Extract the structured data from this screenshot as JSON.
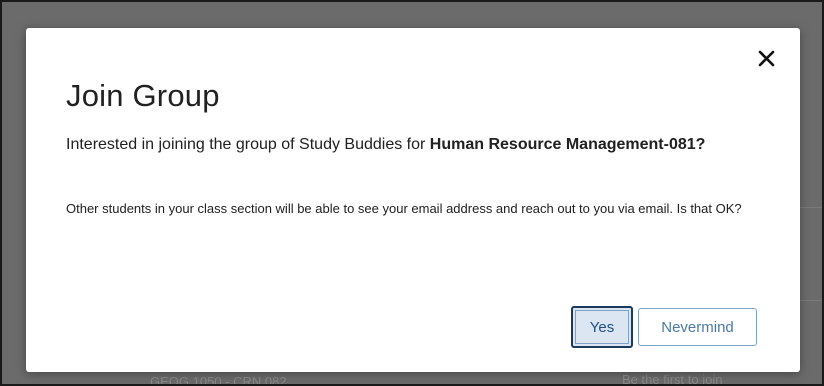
{
  "background": {
    "course_peek": "GEOG 1050 - CRN 082",
    "join_peek": "Be the first to join"
  },
  "dialog": {
    "title": "Join Group",
    "question_prefix": "Interested in joining the group of Study Buddies for ",
    "question_course": "Human Resource Management-081?",
    "notice": "Other students in your class section will be able to see your email address and reach out to you via email. Is that OK?",
    "close_icon": "close-icon",
    "yes_label": "Yes",
    "nevermind_label": "Nevermind"
  },
  "colors": {
    "overlay": "#6b6b6b",
    "yes_bg": "#dbe6f2",
    "yes_border": "#1b3a5c",
    "nevermind_text": "#4a79a8"
  }
}
